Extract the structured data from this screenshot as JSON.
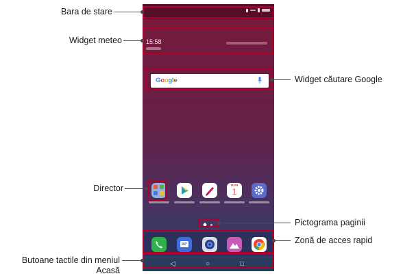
{
  "labels": {
    "status_bar": "Bara de stare",
    "weather_widget": "Widget meteo",
    "google_search_widget": "Widget căutare Google",
    "folder": "Director",
    "page_icon": "Pictograma paginii",
    "quick_access": "Zonă de acces rapid",
    "home_touch_buttons_line1": "Butoane tactile din meniul",
    "home_touch_buttons_line2": "Acasă"
  },
  "screen": {
    "weather_time": "15:58",
    "search_logo": [
      "G",
      "o",
      "o",
      "g",
      "l",
      "e"
    ],
    "nav_buttons": [
      "◁",
      "○",
      "□"
    ]
  },
  "icons": {
    "home_apps": [
      "folder-icon",
      "play-store-icon",
      "qslide-pen-icon",
      "calendar-icon",
      "settings-icon"
    ],
    "dock_apps": [
      "phone-icon",
      "messages-icon",
      "camera-icon",
      "gallery-icon",
      "chrome-icon"
    ]
  },
  "calendar_icon": {
    "month": "MON",
    "day": "1"
  },
  "colors": {
    "highlight": "#b0002a",
    "callout_line": "#4a4a4a",
    "wallpaper_top": "#7a1a3a",
    "wallpaper_bottom": "#2c4470",
    "nav_bar": "#2a3c5c"
  }
}
